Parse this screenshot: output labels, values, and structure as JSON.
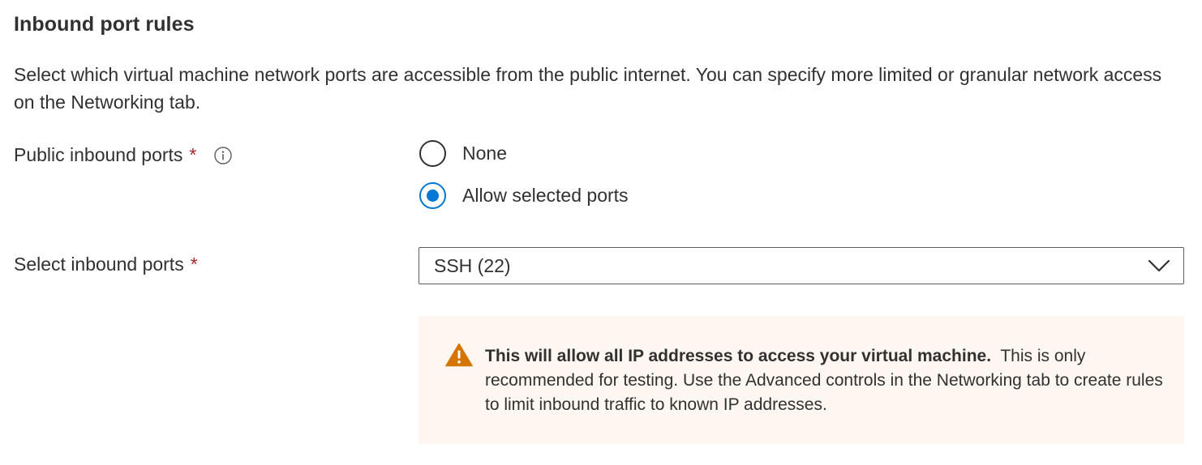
{
  "section": {
    "title": "Inbound port rules",
    "description": "Select which virtual machine network ports are accessible from the public internet. You can specify more limited or granular network access on the Networking tab."
  },
  "public_inbound_ports": {
    "label": "Public inbound ports",
    "required_marker": "*",
    "info_icon": "info-icon",
    "options": [
      {
        "label": "None",
        "selected": false
      },
      {
        "label": "Allow selected ports",
        "selected": true
      }
    ]
  },
  "select_inbound_ports": {
    "label": "Select inbound ports",
    "required_marker": "*",
    "selected_value": "SSH (22)",
    "icon": "chevron-down-icon"
  },
  "warning": {
    "icon": "warning-triangle-icon",
    "bold_text": "This will allow all IP addresses to access your virtual machine.",
    "body_text": "This is only recommended for testing.  Use the Advanced controls in the Networking tab to create rules to limit inbound traffic to known IP addresses."
  },
  "colors": {
    "accent": "#0078d4",
    "required": "#a4262c",
    "warning_icon": "#d47500",
    "warning_background": "#fdf6f1",
    "text": "#323130"
  }
}
